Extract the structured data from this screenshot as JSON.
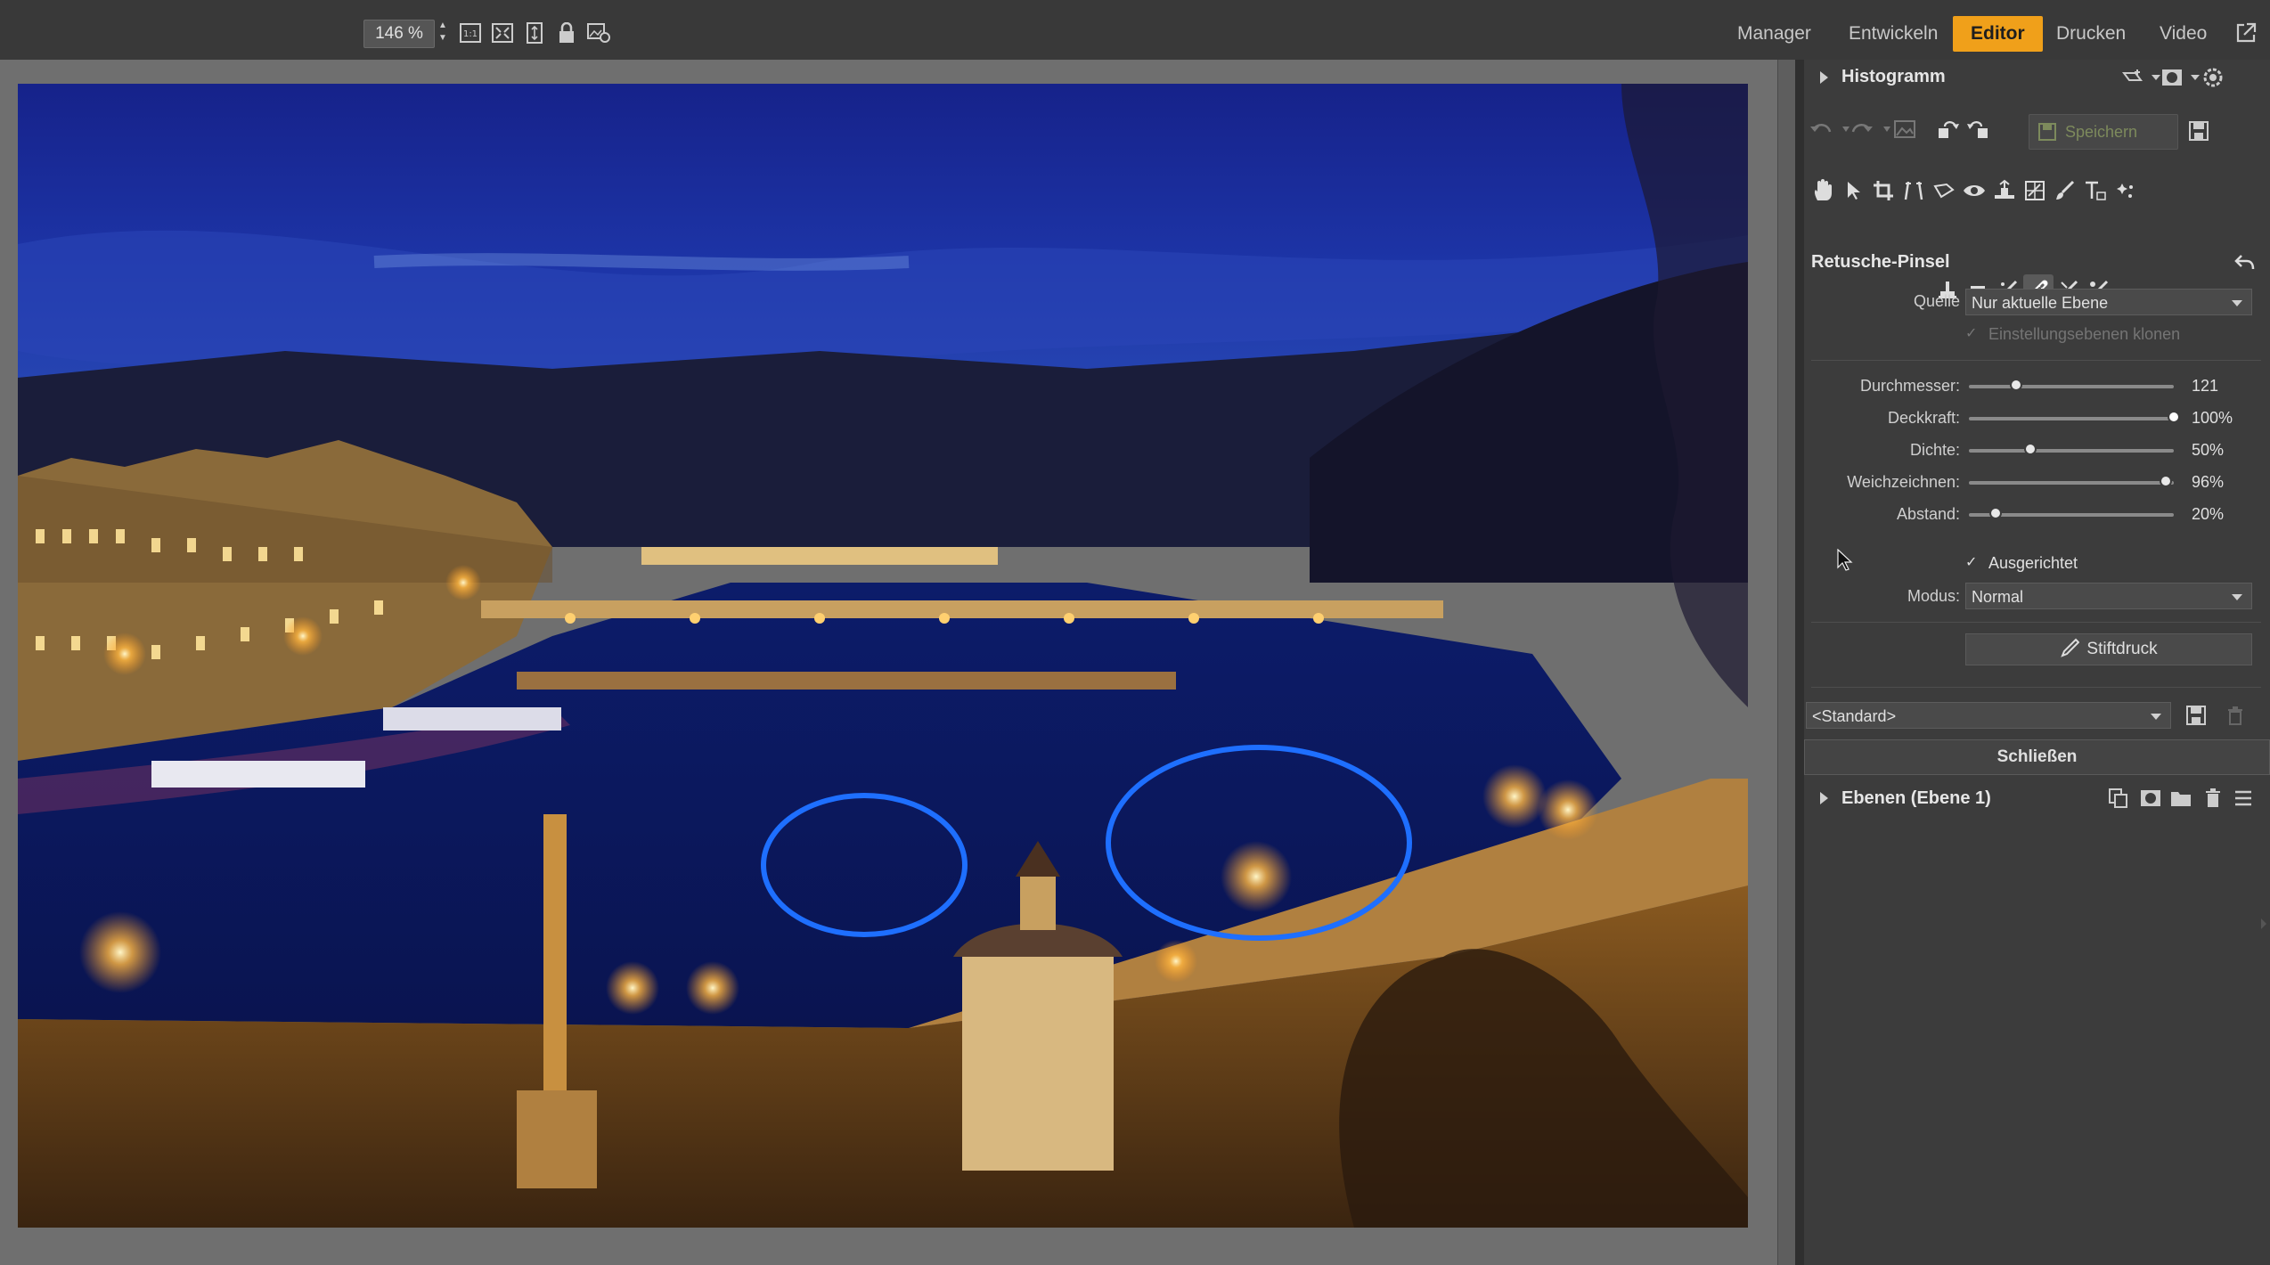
{
  "toolbar": {
    "zoom_value": "146 %",
    "icons": [
      "zoom-1-1-icon",
      "fit-screen-icon",
      "fit-height-icon",
      "lock-icon",
      "compare-icon"
    ]
  },
  "nav": {
    "items": [
      "Manager",
      "Entwickeln",
      "Editor",
      "Drucken",
      "Video"
    ],
    "active": "Editor"
  },
  "histogram": {
    "title": "Histogramm"
  },
  "history": {
    "save_label": "Speichern"
  },
  "tool": {
    "title": "Retusche-Pinsel",
    "source_label": "Quelle",
    "source_value": "Nur aktuelle Ebene",
    "clone_adjustments_label": "Einstellungsebenen klonen",
    "sliders": [
      {
        "label": "Durchmesser:",
        "value": "121",
        "fraction": 0.23
      },
      {
        "label": "Deckkraft:",
        "value": "100%",
        "fraction": 1.0
      },
      {
        "label": "Dichte:",
        "value": "50%",
        "fraction": 0.3
      },
      {
        "label": "Weichzeichnen:",
        "value": "96%",
        "fraction": 0.96
      },
      {
        "label": "Abstand:",
        "value": "20%",
        "fraction": 0.2
      }
    ],
    "aligned_label": "Ausgerichtet",
    "mode_label": "Modus:",
    "mode_value": "Normal",
    "pen_pressure_label": "Stiftdruck",
    "preset_value": "<Standard>",
    "close_label": "Schließen"
  },
  "layers": {
    "title": "Ebenen (Ebene 1)"
  },
  "colors": {
    "accent": "#f0a01a",
    "selection": "#1e6fff"
  }
}
